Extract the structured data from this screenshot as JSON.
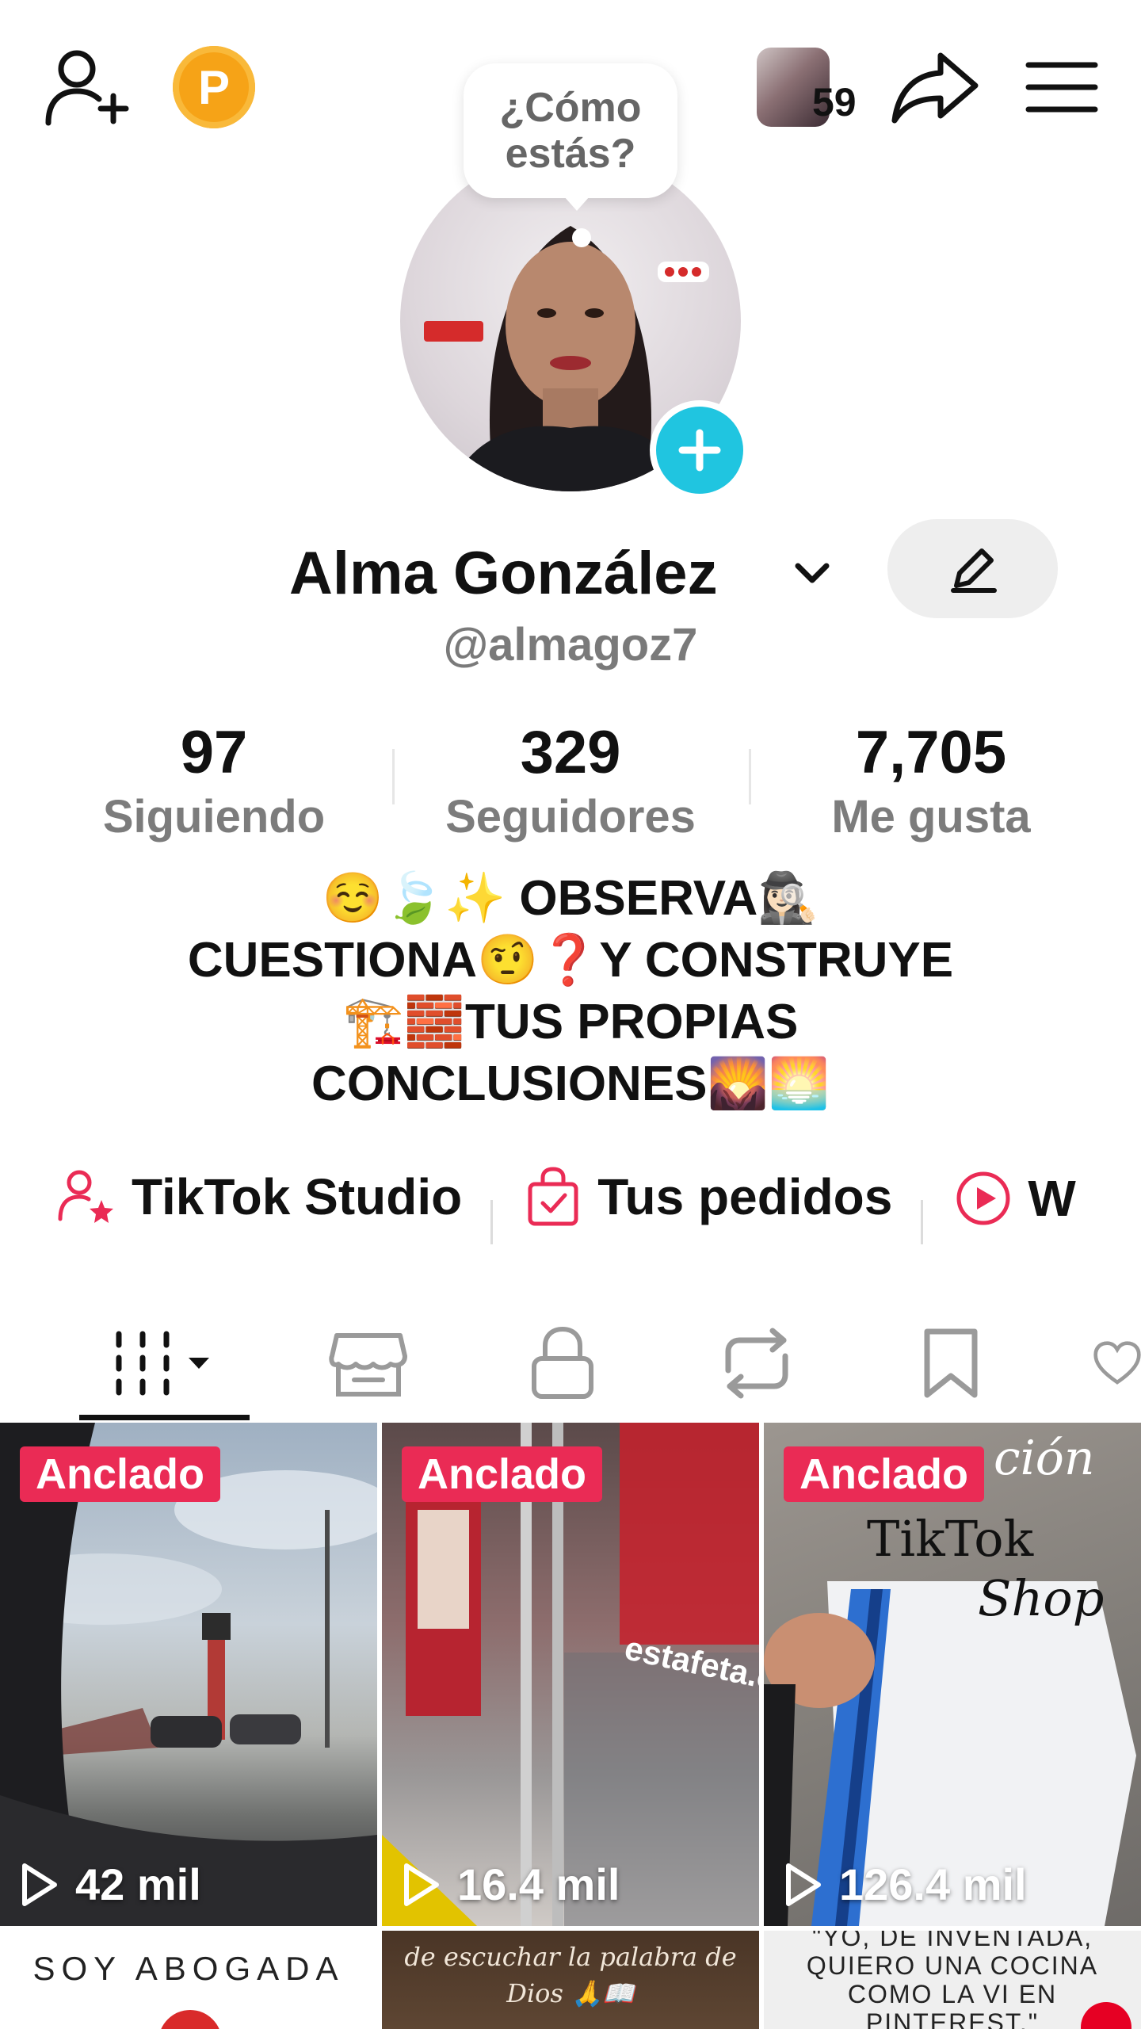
{
  "topbar": {
    "coin_letter": "P",
    "friends_count": "59"
  },
  "profile": {
    "bubble_text": "¿Cómo estás?",
    "name": "Alma González",
    "handle": "@almagoz7"
  },
  "stats": [
    {
      "value": "97",
      "label": "Siguiendo"
    },
    {
      "value": "329",
      "label": "Seguidores"
    },
    {
      "value": "7,705",
      "label": "Me gusta"
    }
  ],
  "bio": {
    "line1": "☺️🍃✨ OBSERVA🕵🏻‍♀️",
    "line2": "CUESTIONA🤨❓Y CONSTRUYE",
    "line3": "🏗️🧱TUS PROPIAS",
    "line4": "CONCLUSIONES🌄🌅"
  },
  "quick_links": [
    {
      "label": "TikTok Studio",
      "icon": "person-star-icon"
    },
    {
      "label": "Tus pedidos",
      "icon": "shopping-bag-icon"
    },
    {
      "label": "W",
      "icon": "play-circle-icon"
    }
  ],
  "tabs": [
    {
      "name": "videos",
      "icon": "grid-icon",
      "active": true
    },
    {
      "name": "shop",
      "icon": "storefront-icon"
    },
    {
      "name": "private",
      "icon": "lock-icon"
    },
    {
      "name": "reposts",
      "icon": "repost-icon"
    },
    {
      "name": "saved",
      "icon": "bookmark-icon"
    },
    {
      "name": "liked",
      "icon": "heart-icon"
    }
  ],
  "videos": [
    {
      "pinned_label": "Anclado",
      "views": "42 mil"
    },
    {
      "pinned_label": "Anclado",
      "views": "16.4 mil",
      "overlay": "estafeta.c"
    },
    {
      "pinned_label": "Anclado",
      "views": "126.4 mil",
      "overlay1": "TikTok",
      "overlay2": "Shop",
      "overlay_script": "ción"
    },
    {
      "overlay": "SOY ABOGADA"
    },
    {
      "overlay1": "de escuchar la palabra de",
      "overlay2": "Dios 🙏📖"
    },
    {
      "overlay1": "\"YO, DE INVENTADA,",
      "overlay2": "QUIERO UNA COCINA",
      "overlay3": "COMO LA VI EN",
      "overlay4": "PINTEREST.\""
    }
  ],
  "colors": {
    "accent_pink": "#ea2b55",
    "avatar_add": "#20c5e0",
    "coin": "#f6a317"
  }
}
